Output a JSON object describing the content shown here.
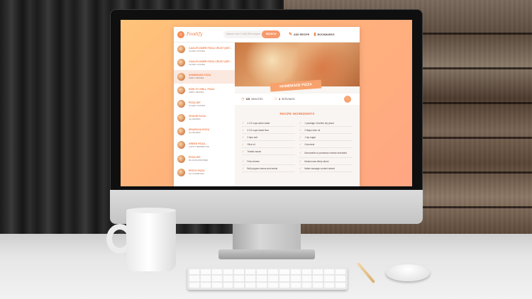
{
  "app": {
    "logo_icon": "chef-hat-icon",
    "logo_text": "Foodify",
    "search_placeholder": "Search over 1,000,000 recipes...",
    "search_button": "SEARCH",
    "nav": [
      {
        "label": "ADD RECIPE",
        "icon": "edit-icon"
      },
      {
        "label": "BOOKMARKS",
        "icon": "bookmark-icon"
      }
    ]
  },
  "sidebar": {
    "items": [
      {
        "title": "CAULIFLOWER PIZZA CRUST (WIT...",
        "author": "CLOSET COOKING",
        "active": false
      },
      {
        "title": "CAULIFLOWER PIZZA CRUST (WIT...",
        "author": "CLOSET COOKING",
        "active": false
      },
      {
        "title": "HOMEMADE PIZZA",
        "author": "SIMPLY RECIPES",
        "active": true
      },
      {
        "title": "HOW TO GRILL PIZZA",
        "author": "SIMPLY RECIPES",
        "active": false
      },
      {
        "title": "PIZZA DIP",
        "author": "CLOSET COOKING",
        "active": false
      },
      {
        "title": "VEGGIE PIZZA",
        "author": "ALL RECIPES",
        "active": false
      },
      {
        "title": "SRIARCHA PIZZA",
        "author": "ALL RECIPES",
        "active": false
      },
      {
        "title": "GREEK PIZZA",
        "author": "A SPICY PERSPECTIVE",
        "active": false
      },
      {
        "title": "PIZZA DIP",
        "author": "BA GOOD APPETIZER",
        "active": false
      },
      {
        "title": "PESTO PIZZA",
        "author": "101 COOKBOOKS",
        "active": false
      }
    ]
  },
  "recipe": {
    "title": "HOMEMADE PIZZA",
    "time_value": "135",
    "time_unit": "MINUTES",
    "servings_value": "4",
    "servings_unit": "SERVINGS",
    "ingredients_heading": "RECIPE INGREDIENTS",
    "ingredients": [
      "1 1/2 cups warm water",
      "1 package of active dry yeast",
      "3 1/2 cups bread flour",
      "2 tbsps olive oil",
      "2 tsps salt",
      "1 tsp sugar",
      "Olive oil",
      "Cornmeal",
      "Tomato sauce",
      "Mozzarella or parmesan cheese shredded",
      "Feta cheese",
      "Mushrooms thinly sliced",
      "Bell peppers stems and seeds",
      "Italian sausage cooked ahead"
    ]
  },
  "colors": {
    "accent": "#f48c54",
    "accent_light": "#f7a26d",
    "screen_gradient_start": "#ffc47a",
    "screen_gradient_end": "#ffa682"
  }
}
